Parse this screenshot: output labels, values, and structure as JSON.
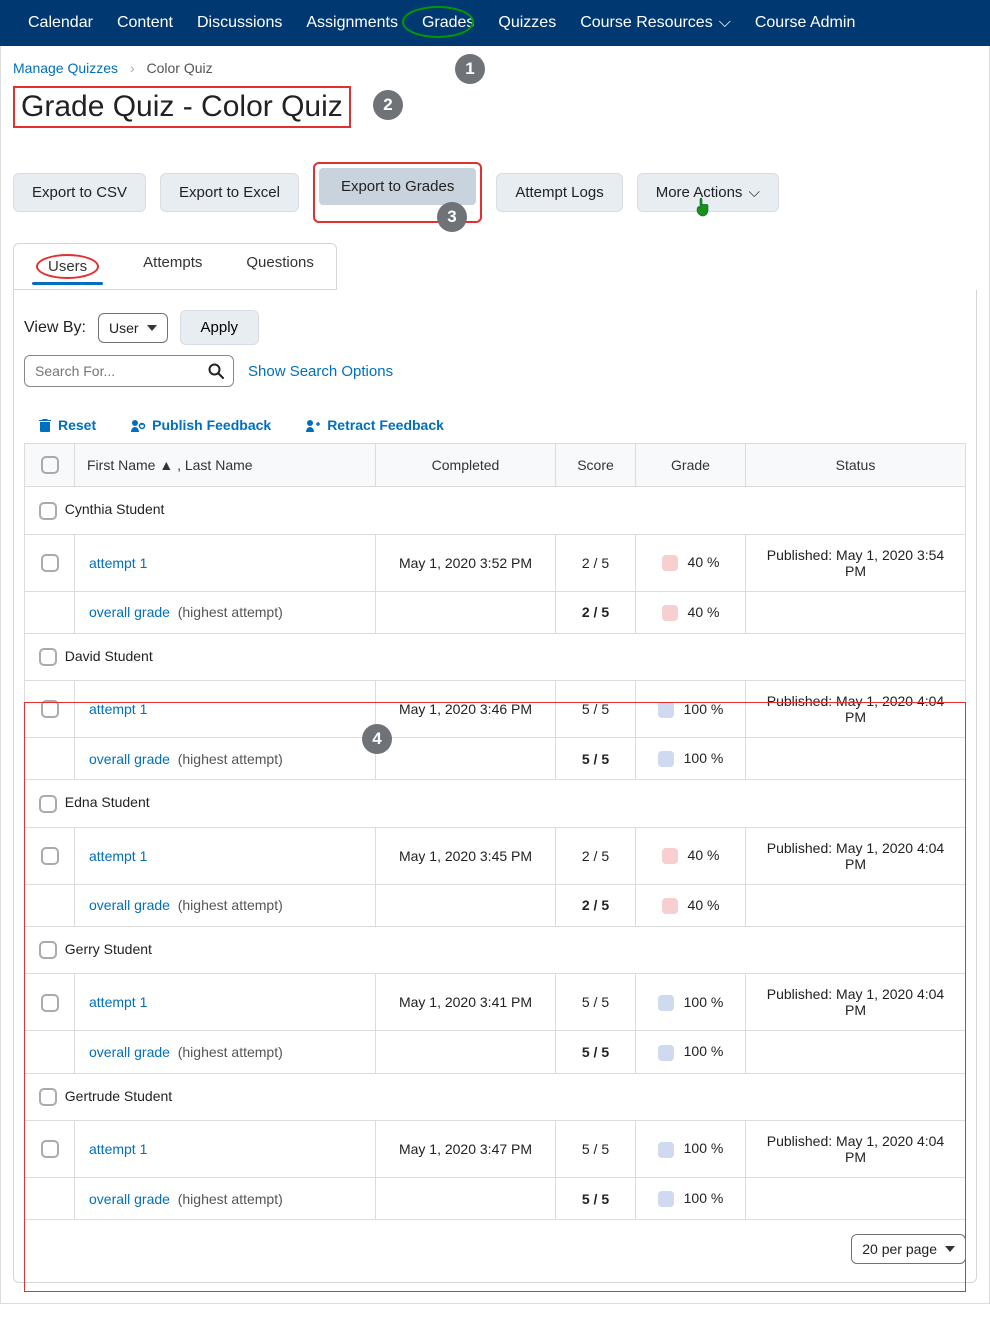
{
  "nav": {
    "items": [
      "Calendar",
      "Content",
      "Discussions",
      "Assignments",
      "Grades",
      "Quizzes",
      "Course Resources",
      "Course Admin"
    ]
  },
  "breadcrumb": {
    "root": "Manage Quizzes",
    "current": "Color Quiz"
  },
  "page_title": "Grade Quiz - Color Quiz",
  "buttons": {
    "export_csv": "Export to CSV",
    "export_excel": "Export to Excel",
    "export_grades": "Export to Grades",
    "attempt_logs": "Attempt Logs",
    "more_actions": "More Actions"
  },
  "tabs": {
    "users": "Users",
    "attempts": "Attempts",
    "questions": "Questions"
  },
  "viewby": {
    "label": "View By:",
    "value": "User",
    "apply": "Apply"
  },
  "search": {
    "placeholder": "Search For...",
    "show_options": "Show Search Options"
  },
  "actions": {
    "reset": "Reset",
    "publish": "Publish Feedback",
    "retract": "Retract Feedback"
  },
  "columns": {
    "name": "First Name ▲ , Last Name",
    "completed": "Completed",
    "score": "Score",
    "grade": "Grade",
    "status": "Status"
  },
  "overall_label": "overall grade",
  "overall_note": "(highest attempt)",
  "attempt_label": "attempt 1",
  "students": [
    {
      "name": "Cynthia Student",
      "completed": "May 1, 2020 3:52 PM",
      "score": "2 / 5",
      "grade": "40 %",
      "grade_level": "low",
      "status": "Published: May 1, 2020 3:54 PM",
      "overall_score": "2 / 5",
      "overall_grade": "40 %"
    },
    {
      "name": "David Student",
      "completed": "May 1, 2020 3:46 PM",
      "score": "5 / 5",
      "grade": "100 %",
      "grade_level": "high",
      "status": "Published: May 1, 2020 4:04 PM",
      "overall_score": "5 / 5",
      "overall_grade": "100 %"
    },
    {
      "name": "Edna Student",
      "completed": "May 1, 2020 3:45 PM",
      "score": "2 / 5",
      "grade": "40 %",
      "grade_level": "low",
      "status": "Published: May 1, 2020 4:04 PM",
      "overall_score": "2 / 5",
      "overall_grade": "40 %"
    },
    {
      "name": "Gerry Student",
      "completed": "May 1, 2020 3:41 PM",
      "score": "5 / 5",
      "grade": "100 %",
      "grade_level": "high",
      "status": "Published: May 1, 2020 4:04 PM",
      "overall_score": "5 / 5",
      "overall_grade": "100 %"
    },
    {
      "name": "Gertrude Student",
      "completed": "May 1, 2020 3:47 PM",
      "score": "5 / 5",
      "grade": "100 %",
      "grade_level": "high",
      "status": "Published: May 1, 2020 4:04 PM",
      "overall_score": "5 / 5",
      "overall_grade": "100 %"
    }
  ],
  "pagination": {
    "value": "20 per page"
  },
  "callouts": {
    "1": "1",
    "2": "2",
    "3": "3",
    "4": "4"
  }
}
